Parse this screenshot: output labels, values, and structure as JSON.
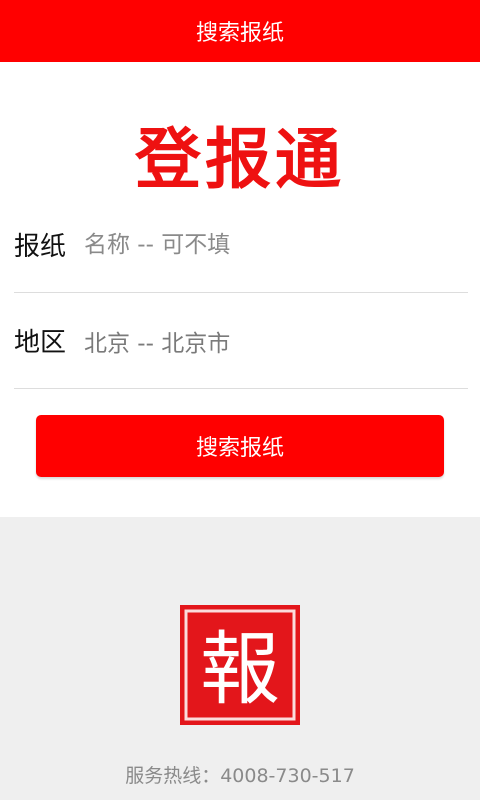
{
  "header": {
    "title": "搜索报纸"
  },
  "brand": {
    "title": "登报通"
  },
  "form": {
    "newspaper": {
      "label": "报纸",
      "placeholder": "名称 -- 可不填"
    },
    "region": {
      "label": "地区",
      "value": "北京 -- 北京市"
    }
  },
  "search_button": {
    "label": "搜索报纸"
  },
  "footer": {
    "logo_text": "報",
    "hotline_label": "服务热线：",
    "hotline_number": "4008-730-517"
  },
  "colors": {
    "accent": "#ff0000",
    "footer_bg": "#efefef"
  }
}
